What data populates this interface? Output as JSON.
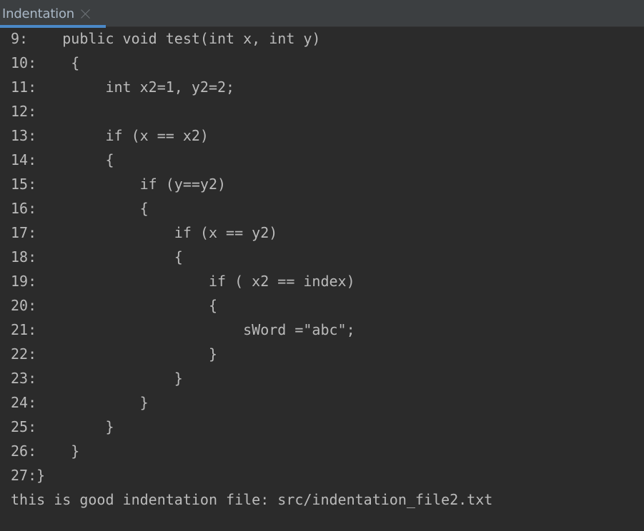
{
  "tab": {
    "title": "Indentation",
    "close_icon": "close-icon"
  },
  "console": {
    "lines": [
      "9:    public void test(int x, int y)",
      "10:    {",
      "11:        int x2=1, y2=2;",
      "12:",
      "13:        if (x == x2)",
      "14:        {",
      "15:            if (y==y2)",
      "16:            {",
      "17:                if (x == y2)",
      "18:                {",
      "19:                    if ( x2 == index)",
      "20:                    {",
      "21:                        sWord =\"abc\";",
      "22:                    }",
      "23:                }",
      "24:            }",
      "25:        }",
      "26:    }",
      "27:}",
      "this is good indentation file: src/indentation_file2.txt"
    ]
  },
  "colors": {
    "background": "#2b2b2b",
    "tabbar": "#3c3f41",
    "tab_active_underline": "#4a88c7",
    "text": "#bbbbbb"
  }
}
